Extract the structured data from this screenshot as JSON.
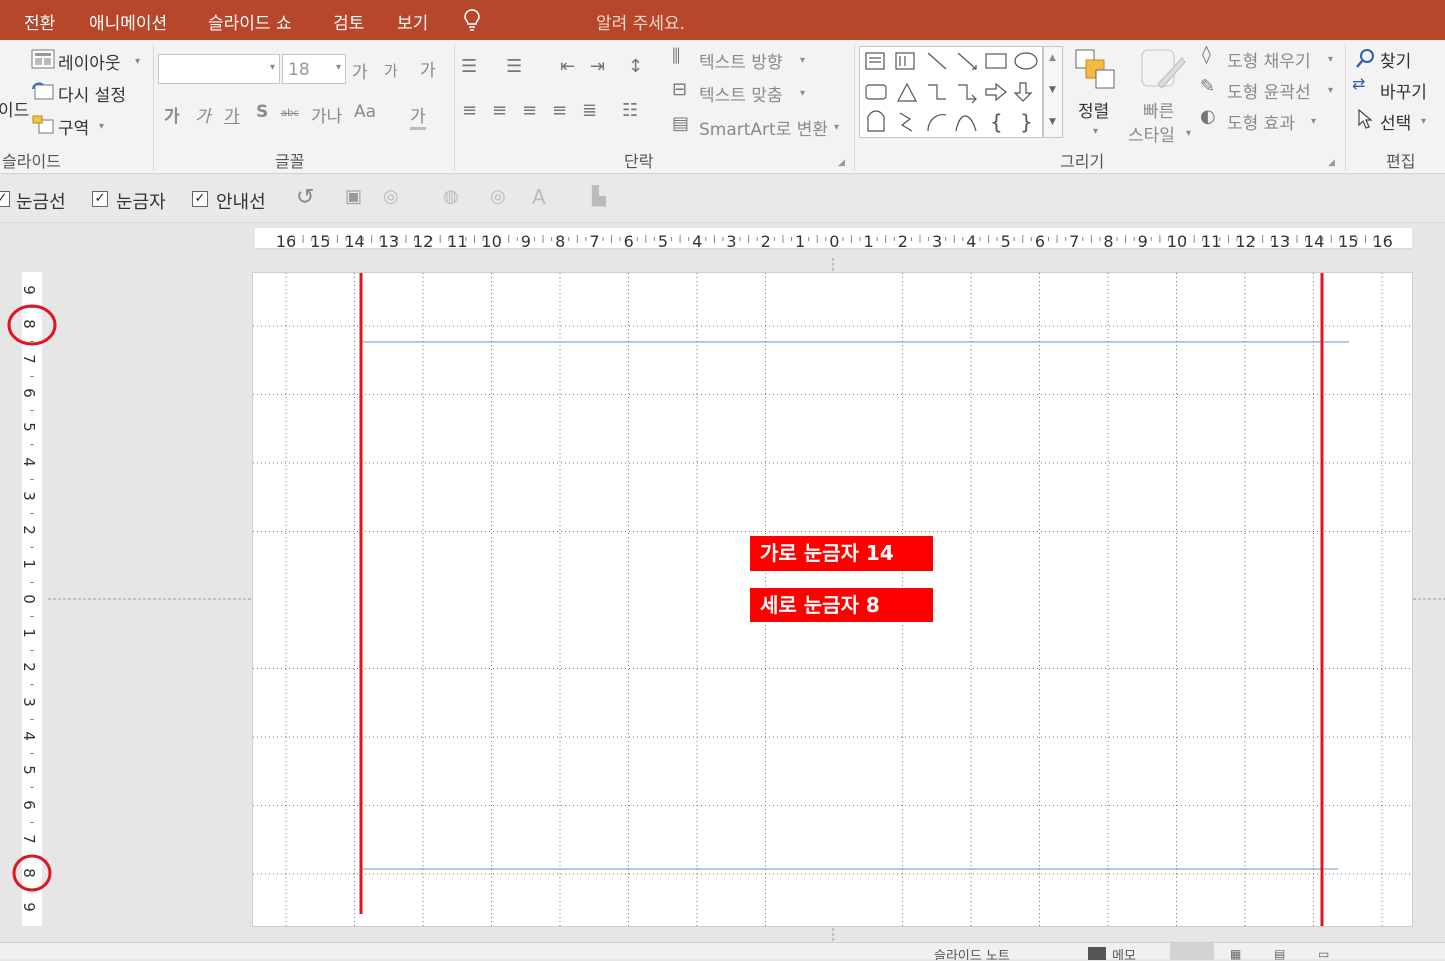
{
  "tabs": [
    "전환",
    "애니메이션",
    "슬라이드 쇼",
    "검토",
    "보기"
  ],
  "tell_me": "알려 주세요.",
  "slides_group": {
    "layout": "레이아웃",
    "reset": "다시 설정",
    "section": "구역",
    "label": "슬라이드",
    "clipped_left": "이드"
  },
  "font_group": {
    "font_size": "18",
    "grow": "가",
    "shrink": "가",
    "clear": "가",
    "bold": "가",
    "italic": "가",
    "underline": "가",
    "shadow": "S",
    "strike": "abc",
    "spacing": "가나",
    "case": "Aa",
    "color": "가",
    "label": "글꼴"
  },
  "paragraph_group": {
    "text_direction": "텍스트 방향",
    "align_text": "텍스트 맞춤",
    "smartart": "SmartArt로 변환",
    "label": "단락"
  },
  "drawing_group": {
    "arrange": "정렬",
    "quick_styles_1": "빠른",
    "quick_styles_2": "스타일",
    "fill": "도형 채우기",
    "outline": "도형 윤곽선",
    "effects": "도형 효과",
    "label": "그리기"
  },
  "editing_group": {
    "find": "찾기",
    "replace": "바꾸기",
    "select": "선택",
    "label": "편집"
  },
  "view_options": {
    "gridlines": "눈금선",
    "ruler": "눈금자",
    "guides": "안내선"
  },
  "ruler_h": [
    "16",
    "15",
    "14",
    "13",
    "12",
    "11",
    "10",
    "9",
    "8",
    "7",
    "6",
    "5",
    "4",
    "3",
    "2",
    "1",
    "0",
    "1",
    "2",
    "3",
    "4",
    "5",
    "6",
    "7",
    "8",
    "9",
    "10",
    "11",
    "12",
    "13",
    "14",
    "15",
    "16"
  ],
  "ruler_v": [
    "9",
    "8",
    "7",
    "6",
    "5",
    "4",
    "3",
    "2",
    "1",
    "0",
    "1",
    "2",
    "3",
    "4",
    "5",
    "6",
    "7",
    "8",
    "9"
  ],
  "slide": {
    "label_h": "가로 눈금자 14",
    "label_v": "세로 눈금자  8"
  },
  "status": {
    "notes": "슬라이드 노트",
    "memo": "메모"
  },
  "colors": {
    "accent": "#b7472a",
    "marker": "#e0161e",
    "guide_blue": "#5b9bd5"
  }
}
